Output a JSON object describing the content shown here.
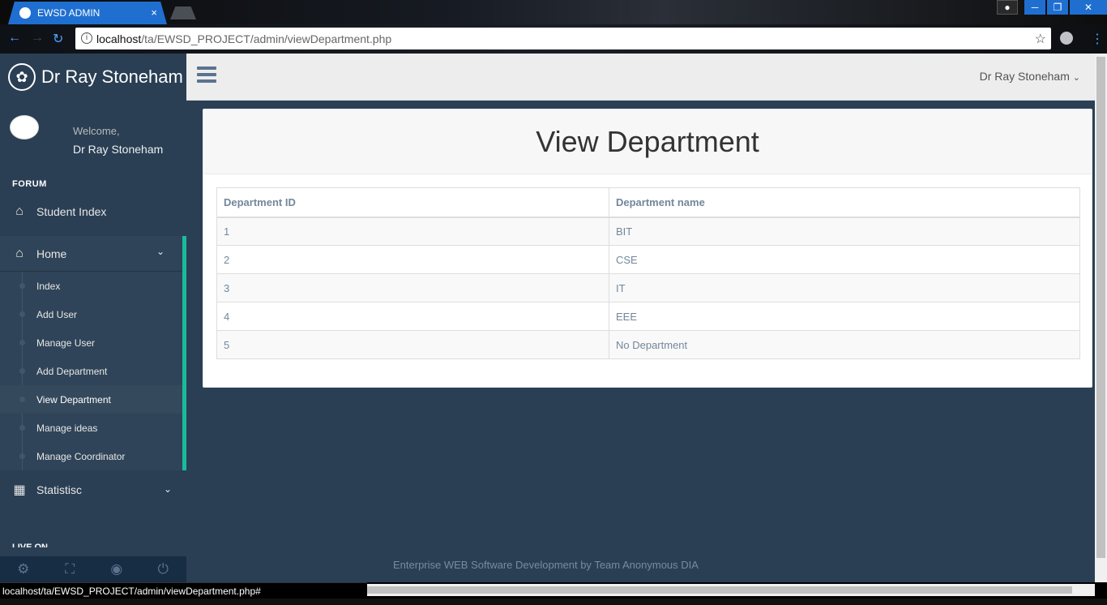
{
  "browser": {
    "tab_title": "EWSD ADMIN",
    "tab_close": "×",
    "url_host": "localhost",
    "url_path": "/ta/EWSD_PROJECT/admin/viewDepartment.php",
    "status_url": "localhost/ta/EWSD_PROJECT/admin/viewDepartment.php#"
  },
  "sidebar": {
    "brand": "Dr Ray Stoneham",
    "welcome": "Welcome,",
    "user_name": "Dr Ray Stoneham",
    "section_title": "FORUM",
    "student_index": "Student Index",
    "home": "Home",
    "home_items": [
      {
        "label": "Index"
      },
      {
        "label": "Add User"
      },
      {
        "label": "Manage User"
      },
      {
        "label": "Add Department"
      },
      {
        "label": "View Department"
      },
      {
        "label": "Manage ideas"
      },
      {
        "label": "Manage Coordinator"
      }
    ],
    "statistic": "Statistisc",
    "live_on": "LIVE ON"
  },
  "topnav": {
    "user_menu": "Dr Ray Stoneham"
  },
  "main": {
    "title": "View Department",
    "columns": [
      "Department ID",
      "Department name"
    ],
    "rows": [
      [
        "1",
        "BIT"
      ],
      [
        "2",
        "CSE"
      ],
      [
        "3",
        "IT"
      ],
      [
        "4",
        "EEE"
      ],
      [
        "5",
        "No Department"
      ]
    ]
  },
  "footer": {
    "text": "Enterprise WEB Software Development by Team Anonymous DIA"
  },
  "colors": {
    "sidebar_bg": "#2a3f54",
    "accent": "#1abb9c",
    "browser_tab": "#1f6fd1"
  }
}
